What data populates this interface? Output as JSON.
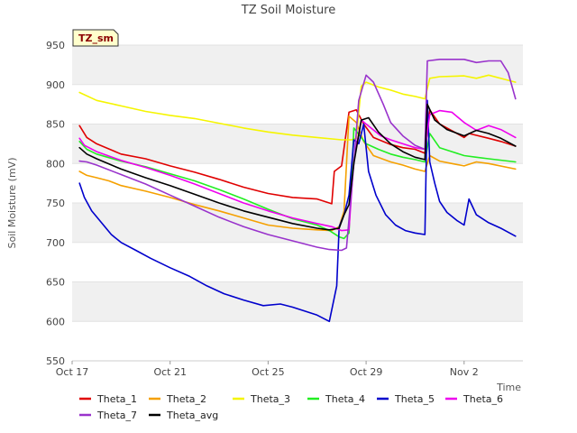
{
  "chart_data": {
    "type": "line",
    "title": "TZ Soil Moisture",
    "xlabel": "Time",
    "ylabel": "Soil Moisture (mV)",
    "badge": "TZ_sm",
    "ylim": [
      550,
      950
    ],
    "yticks": [
      550,
      600,
      650,
      700,
      750,
      800,
      850,
      900,
      950
    ],
    "xlim": [
      0,
      18.4
    ],
    "xticks": [
      {
        "day": 0,
        "label": "Oct 17"
      },
      {
        "day": 4,
        "label": "Oct 21"
      },
      {
        "day": 8,
        "label": "Oct 25"
      },
      {
        "day": 12,
        "label": "Oct 29"
      },
      {
        "day": 16,
        "label": "Nov 2"
      }
    ],
    "grid": "horizontal bands",
    "legend_position": "bottom",
    "colors": {
      "Theta_1": "#e00000",
      "Theta_2": "#f5a000",
      "Theta_3": "#f5f500",
      "Theta_4": "#22ee22",
      "Theta_5": "#0000cc",
      "Theta_6": "#ee00ee",
      "Theta_7": "#9933cc",
      "Theta_avg": "#000000"
    },
    "series": [
      {
        "name": "Theta_1",
        "x": [
          0.3,
          0.6,
          1,
          2,
          3,
          4,
          5,
          6,
          7,
          8,
          9,
          10,
          10.6,
          10.7,
          11.0,
          11.3,
          11.6,
          11.9,
          12.3,
          13,
          13.5,
          14,
          14.4,
          14.6,
          15,
          15.6,
          16,
          16.2,
          17,
          17.5,
          18.1
        ],
        "y": [
          848,
          833,
          825,
          812,
          806,
          797,
          789,
          780,
          770,
          762,
          757,
          755,
          749,
          790,
          797,
          865,
          868,
          850,
          833,
          824,
          820,
          818,
          813,
          868,
          850,
          840,
          833,
          838,
          832,
          828,
          822
        ]
      },
      {
        "name": "Theta_2",
        "x": [
          0.3,
          0.6,
          1,
          1.5,
          2,
          3,
          4,
          5,
          6,
          7,
          8,
          9,
          10,
          10.6,
          10.9,
          11.1,
          11.3,
          11.6,
          11.9,
          12.3,
          13,
          13.5,
          14,
          14.4,
          14.6,
          15,
          15.5,
          16,
          16.5,
          17,
          18.1
        ],
        "y": [
          790,
          785,
          782,
          778,
          772,
          765,
          757,
          748,
          740,
          731,
          722,
          718,
          716,
          715,
          720,
          740,
          860,
          852,
          828,
          810,
          802,
          798,
          793,
          790,
          810,
          803,
          800,
          797,
          802,
          800,
          793
        ]
      },
      {
        "name": "Theta_3",
        "x": [
          0.3,
          1,
          2,
          3,
          4,
          5,
          6,
          7,
          8,
          9,
          10,
          11,
          11.4,
          11.6,
          11.8,
          12,
          12.5,
          13,
          13.5,
          14,
          14.4,
          14.6,
          15,
          16,
          16.5,
          17,
          18.1
        ],
        "y": [
          890,
          880,
          873,
          866,
          861,
          857,
          851,
          845,
          840,
          836,
          833,
          830,
          830,
          832,
          898,
          903,
          897,
          893,
          888,
          885,
          882,
          908,
          910,
          911,
          908,
          912,
          903
        ]
      },
      {
        "name": "Theta_4",
        "x": [
          0.3,
          0.6,
          1,
          2,
          3,
          4,
          5,
          6,
          7,
          8,
          9,
          10,
          10.5,
          10.9,
          11.1,
          11.3,
          11.5,
          11.7,
          12,
          12.5,
          13,
          13.5,
          14,
          14.4,
          14.6,
          15,
          15.5,
          16,
          16.5,
          17,
          18.1
        ],
        "y": [
          828,
          818,
          812,
          803,
          796,
          787,
          778,
          767,
          755,
          742,
          730,
          722,
          715,
          707,
          705,
          712,
          845,
          837,
          825,
          818,
          812,
          808,
          805,
          802,
          838,
          820,
          815,
          810,
          808,
          806,
          802
        ]
      },
      {
        "name": "Theta_5",
        "x": [
          0.3,
          0.5,
          0.8,
          1.2,
          1.6,
          2,
          2.6,
          3.2,
          4,
          4.8,
          5.5,
          6.2,
          7,
          7.8,
          8.5,
          9,
          9.6,
          10,
          10.5,
          10.8,
          10.9,
          11.1,
          11.3,
          11.5,
          11.7,
          11.9,
          12.1,
          12.4,
          12.8,
          13.2,
          13.6,
          14,
          14.4,
          14.5,
          14.6,
          14.8,
          15,
          15.3,
          15.7,
          16,
          16.2,
          16.5,
          17,
          17.5,
          18.1
        ],
        "y": [
          775,
          757,
          740,
          725,
          710,
          700,
          690,
          680,
          668,
          657,
          645,
          635,
          627,
          620,
          622,
          618,
          612,
          608,
          600,
          645,
          720,
          735,
          760,
          830,
          825,
          850,
          790,
          760,
          735,
          722,
          715,
          712,
          710,
          880,
          802,
          775,
          752,
          738,
          728,
          722,
          755,
          735,
          725,
          718,
          708
        ]
      },
      {
        "name": "Theta_6",
        "x": [
          0.3,
          0.5,
          1,
          2,
          3,
          4,
          5,
          6,
          7,
          8,
          9,
          10,
          10.6,
          11,
          11.3,
          11.5,
          11.8,
          12.2,
          12.6,
          13,
          13.5,
          14,
          14.4,
          14.6,
          15,
          15.5,
          16,
          16.5,
          17,
          17.5,
          18.1
        ],
        "y": [
          832,
          823,
          815,
          804,
          795,
          785,
          774,
          762,
          750,
          740,
          731,
          724,
          720,
          715,
          716,
          805,
          855,
          845,
          835,
          830,
          825,
          820,
          818,
          862,
          867,
          865,
          852,
          842,
          848,
          843,
          833
        ]
      },
      {
        "name": "Theta_7",
        "x": [
          0.3,
          0.6,
          1,
          2,
          3,
          4,
          5,
          6,
          7,
          8,
          9,
          10,
          10.5,
          11,
          11.2,
          11.5,
          11.7,
          12,
          12.3,
          12.7,
          13,
          13.5,
          14,
          14.4,
          14.5,
          15,
          16,
          16.5,
          17,
          17.5,
          17.8,
          18.1
        ],
        "y": [
          803,
          802,
          798,
          786,
          774,
          760,
          746,
          732,
          720,
          710,
          702,
          694,
          691,
          690,
          693,
          800,
          880,
          912,
          903,
          875,
          852,
          835,
          823,
          818,
          930,
          932,
          932,
          928,
          930,
          930,
          915,
          882
        ]
      },
      {
        "name": "Theta_avg",
        "x": [
          0.3,
          0.6,
          1,
          2,
          3,
          4,
          5,
          6,
          7,
          8,
          9,
          10,
          10.5,
          10.9,
          11.1,
          11.3,
          11.5,
          11.8,
          12.1,
          12.5,
          13,
          13.5,
          14,
          14.4,
          14.5,
          14.8,
          15.3,
          16,
          16.5,
          17,
          17.5,
          18.1
        ],
        "y": [
          820,
          812,
          806,
          793,
          782,
          772,
          761,
          750,
          740,
          732,
          724,
          718,
          716,
          718,
          735,
          748,
          800,
          855,
          858,
          840,
          825,
          815,
          808,
          805,
          875,
          855,
          843,
          835,
          842,
          838,
          832,
          822
        ]
      }
    ]
  }
}
